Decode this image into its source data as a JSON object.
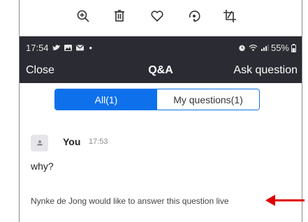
{
  "toolbar": {
    "tools": [
      "zoom-in-icon",
      "trash-icon",
      "heart-icon",
      "rotate-icon",
      "crop-icon"
    ]
  },
  "statusbar": {
    "time": "17:54",
    "battery": "55%"
  },
  "navbar": {
    "close_label": "Close",
    "title": "Q&A",
    "ask_label": "Ask question"
  },
  "tabs": {
    "all_label": "All(1)",
    "mine_label": "My questions(1)"
  },
  "question": {
    "author": "You",
    "time": "17:53",
    "text": "why?",
    "live_note": "Nynke de Jong would like to answer this question live"
  },
  "colors": {
    "accent": "#0e71eb",
    "bar_bg": "#2b2b33",
    "arrow": "#e00000"
  }
}
